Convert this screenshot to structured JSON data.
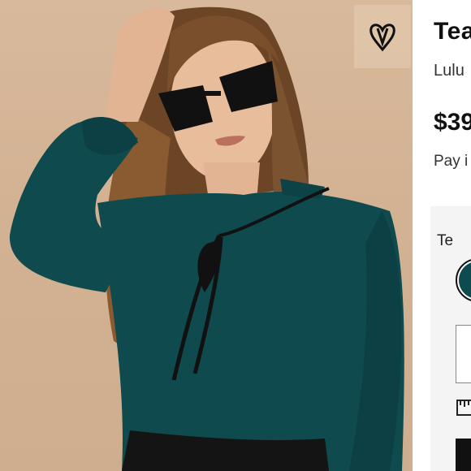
{
  "product": {
    "title": "Tea",
    "brand": "Lulu",
    "price": "$39",
    "pay_text": "Pay i",
    "color_label": "Te",
    "swatch_color": "#0e4b4f"
  },
  "icons": {
    "favorite": "heart-icon",
    "size_guide": "ruler-icon"
  },
  "colors": {
    "background_photo": "#d6b697",
    "blouse": "#0f4a4e",
    "accent": "#111111"
  }
}
